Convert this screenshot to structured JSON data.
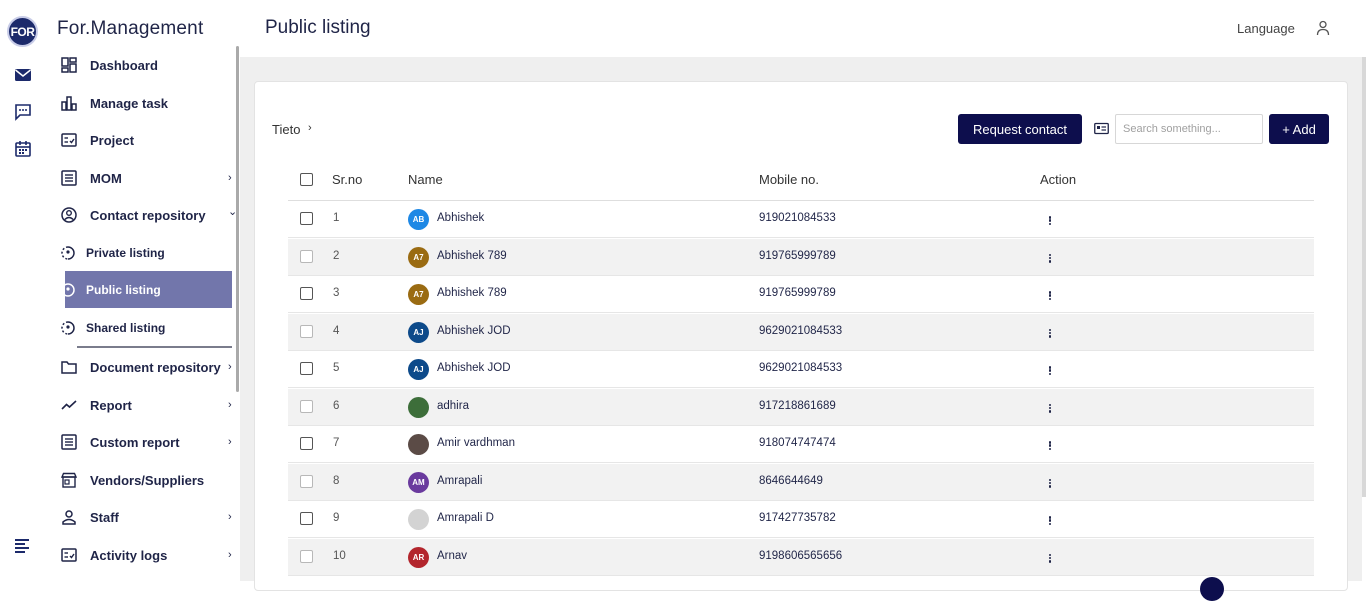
{
  "app": {
    "logo_text": "FOR",
    "title": "For.Management"
  },
  "rail": {
    "icons": [
      "mail-icon",
      "chat-icon",
      "calendar-icon",
      "menu-icon"
    ]
  },
  "sidebar": {
    "items": [
      {
        "label": "Dashboard",
        "icon": "dashboard-icon"
      },
      {
        "label": "Manage task",
        "icon": "bar-chart-icon"
      },
      {
        "label": "Project",
        "icon": "project-icon"
      },
      {
        "label": "MOM",
        "icon": "list-icon",
        "chevron": "›"
      },
      {
        "label": "Contact repository",
        "icon": "contact-icon",
        "chevron": "⌄"
      },
      {
        "label": "Document repository",
        "icon": "folder-icon",
        "chevron": "›"
      },
      {
        "label": "Report",
        "icon": "trend-icon",
        "chevron": "›"
      },
      {
        "label": "Custom report",
        "icon": "custom-report-icon",
        "chevron": "›"
      },
      {
        "label": "Vendors/Suppliers",
        "icon": "store-icon"
      },
      {
        "label": "Staff",
        "icon": "person-icon",
        "chevron": "›"
      },
      {
        "label": "Activity logs",
        "icon": "activity-icon",
        "chevron": "›"
      }
    ],
    "sub_items": [
      {
        "label": "Private listing"
      },
      {
        "label": "Public listing",
        "active": true
      },
      {
        "label": "Shared listing"
      }
    ]
  },
  "header": {
    "title": "Public listing",
    "language": "Language"
  },
  "toolbar": {
    "breadcrumb": "Tieto",
    "breadcrumb_chevron": "›",
    "request_label": "Request contact",
    "search_placeholder": "Search something...",
    "add_label": "+ Add"
  },
  "table": {
    "columns": [
      "Sr.no",
      "Name",
      "Mobile no.",
      "Action"
    ],
    "rows": [
      {
        "sr": "1",
        "initials": "AB",
        "color": "#1e88e5",
        "name": "Abhishek",
        "mobile": "919021084533"
      },
      {
        "sr": "2",
        "initials": "A7",
        "color": "#9a6b12",
        "name": "Abhishek 789",
        "mobile": "919765999789"
      },
      {
        "sr": "3",
        "initials": "A7",
        "color": "#9a6b12",
        "name": "Abhishek 789",
        "mobile": "919765999789"
      },
      {
        "sr": "4",
        "initials": "AJ",
        "color": "#0d4a8a",
        "name": "Abhishek JOD",
        "mobile": "9629021084533"
      },
      {
        "sr": "5",
        "initials": "AJ",
        "color": "#0d4a8a",
        "name": "Abhishek JOD",
        "mobile": "9629021084533"
      },
      {
        "sr": "6",
        "initials": "",
        "color": "#3d6e3a",
        "name": "adhira",
        "mobile": "917218861689"
      },
      {
        "sr": "7",
        "initials": "",
        "color": "#5b4b46",
        "name": "Amir vardhman",
        "mobile": "918074747474"
      },
      {
        "sr": "8",
        "initials": "AM",
        "color": "#6a3a9e",
        "name": "Amrapali",
        "mobile": "8646644649"
      },
      {
        "sr": "9",
        "initials": "",
        "color": "#d3d3d3",
        "name": "Amrapali D",
        "mobile": "917427735782"
      },
      {
        "sr": "10",
        "initials": "AR",
        "color": "#b3262d",
        "name": "Arnav",
        "mobile": "9198606565656"
      }
    ]
  }
}
